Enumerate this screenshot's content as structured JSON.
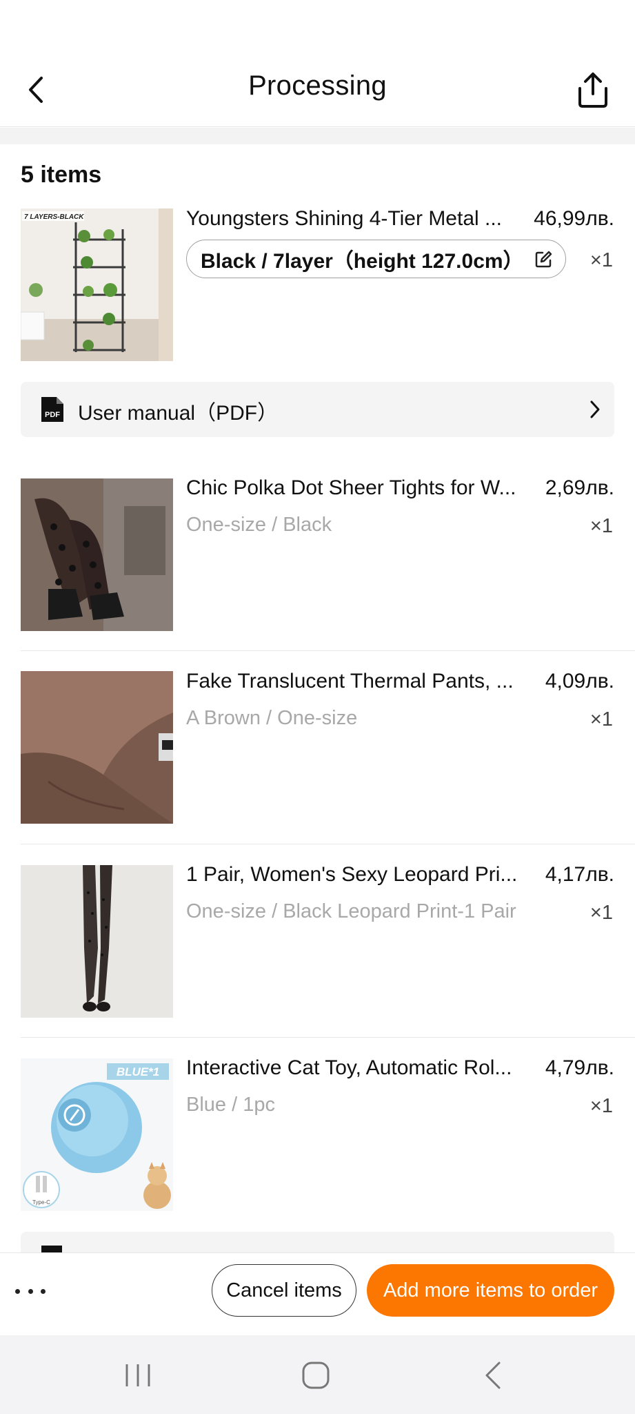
{
  "header": {
    "title": "Processing",
    "back_icon": "chevron-left-icon",
    "share_icon": "share-icon"
  },
  "items_count": "5 items",
  "items": [
    {
      "title": "Youngsters Shining 4-Tier Metal ...",
      "price": "46,99лв.",
      "variant": "Black / 7layer（height 127.0cm）",
      "qty": "×1",
      "thumb_text": "7 LAYERS-BLACK"
    },
    {
      "title": "Chic Polka Dot Sheer Tights for W...",
      "price": "2,69лв.",
      "variant": "One-size / Black",
      "qty": "×1"
    },
    {
      "title": "Fake Translucent Thermal Pants, ...",
      "price": "4,09лв.",
      "variant": "A Brown / One-size",
      "qty": "×1"
    },
    {
      "title": "1 Pair, Women's Sexy Leopard Pri...",
      "price": "4,17лв.",
      "variant": "One-size / Black Leopard Print-1 Pair",
      "qty": "×1"
    },
    {
      "title": "Interactive Cat Toy, Automatic Rol...",
      "price": "4,79лв.",
      "variant": "Blue / 1pc",
      "qty": "×1",
      "thumb_badge": "BLUE*1",
      "thumb_small": "Type-C"
    }
  ],
  "manual": {
    "label": "User manual（PDF）",
    "icon": "pdf-icon"
  },
  "bottom_bar": {
    "more_icon": "more-dots-icon",
    "cancel_label": "Cancel items",
    "add_label": "Add more items to order"
  },
  "colors": {
    "accent": "#fb7701",
    "muted_text": "#a8a8a8",
    "row_bg": "#f4f4f4"
  }
}
